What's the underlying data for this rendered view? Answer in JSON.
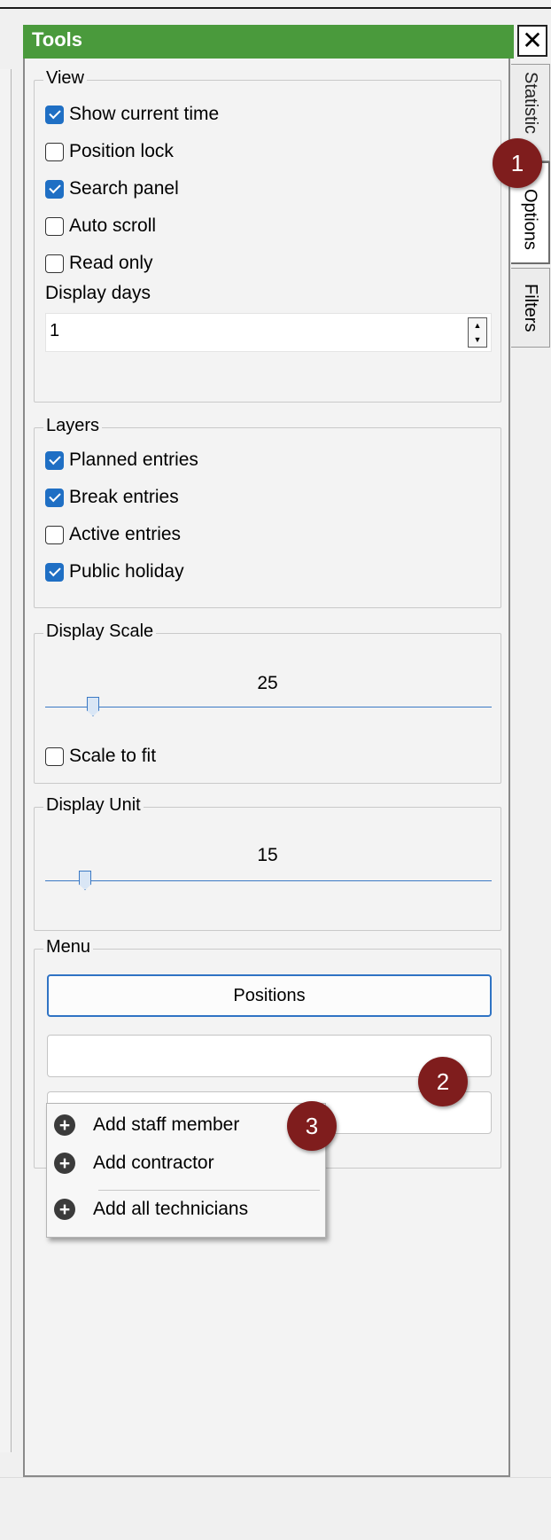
{
  "panel": {
    "title": "Tools",
    "close_symbol": "✕"
  },
  "tabs": [
    {
      "label": "Statistics",
      "shown": "Statistic"
    },
    {
      "label": "Options"
    },
    {
      "label": "Filters"
    }
  ],
  "view": {
    "legend": "View",
    "checkboxes": [
      {
        "label": "Show current time",
        "checked": true
      },
      {
        "label": "Position lock",
        "checked": false
      },
      {
        "label": "Search panel",
        "checked": true
      },
      {
        "label": "Auto scroll",
        "checked": false
      },
      {
        "label": "Read only",
        "checked": false
      }
    ],
    "display_days_label": "Display days",
    "display_days_value": "1"
  },
  "layers": {
    "legend": "Layers",
    "checkboxes": [
      {
        "label": "Planned entries",
        "checked": true
      },
      {
        "label": "Break entries",
        "checked": true
      },
      {
        "label": "Active entries",
        "checked": false
      },
      {
        "label": "Public holiday",
        "checked": true
      }
    ]
  },
  "display_scale": {
    "legend": "Display Scale",
    "value": "25",
    "scale_to_fit_label": "Scale to fit",
    "scale_to_fit_checked": false
  },
  "display_unit": {
    "legend": "Display Unit",
    "value": "15"
  },
  "menu": {
    "legend": "Menu",
    "positions_button": "Positions",
    "dropdown": [
      {
        "label": "Add staff member",
        "icon": "plus-circle-icon"
      },
      {
        "label": "Add contractor",
        "icon": "plus-circle-icon"
      },
      {
        "label": "Add all technicians",
        "icon": "plus-circle-icon"
      }
    ]
  },
  "callouts": [
    "1",
    "2",
    "3"
  ],
  "colors": {
    "title_bar": "#4a9a3c",
    "checkbox_checked": "#1f6fc4",
    "callout": "#7f1d1d"
  }
}
